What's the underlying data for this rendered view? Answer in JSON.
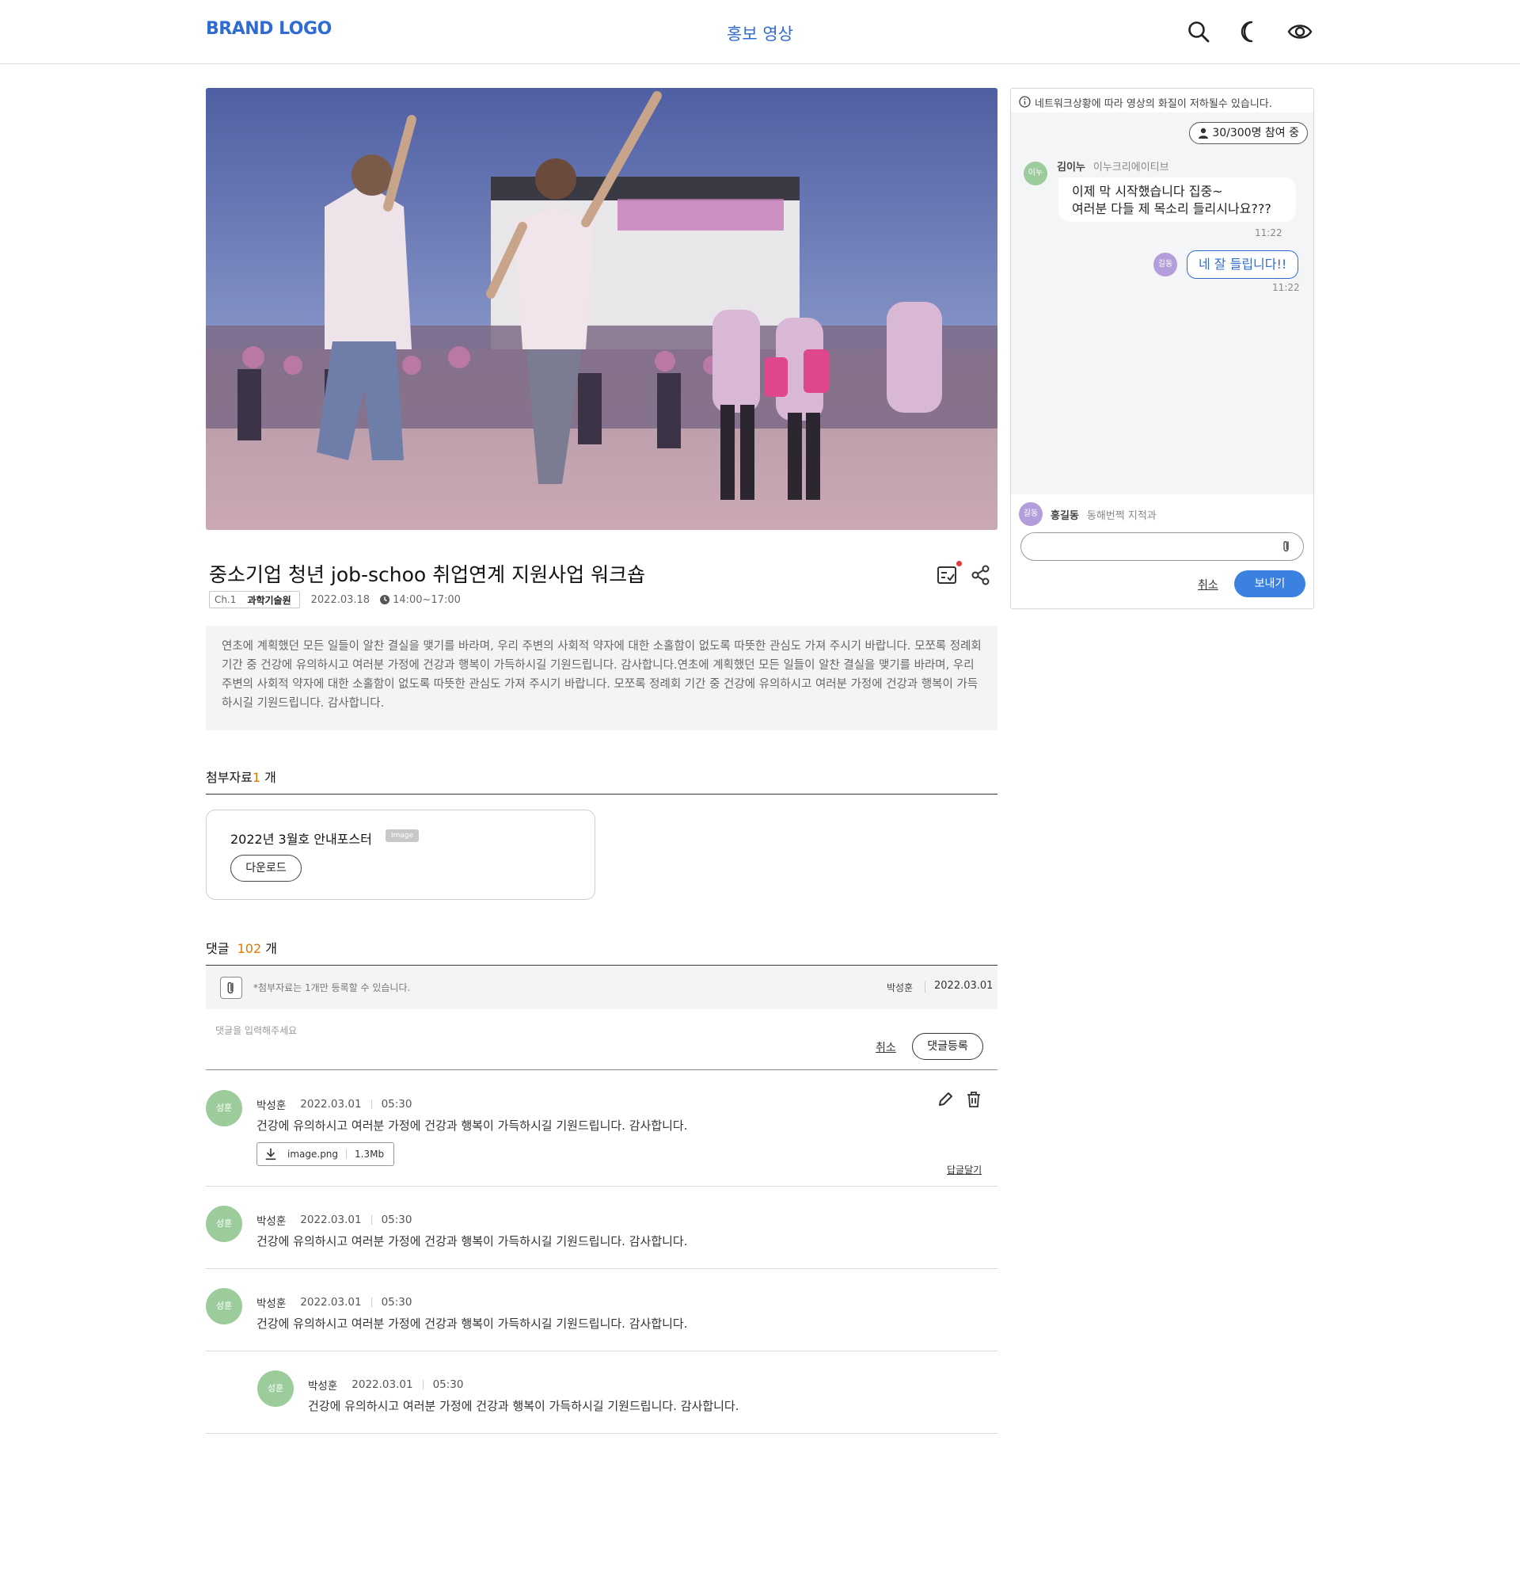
{
  "header": {
    "brand": "BRAND LOGO",
    "title": "홍보 영상",
    "icons": [
      "search-icon",
      "dark-mode-icon",
      "eye-icon"
    ]
  },
  "video": {
    "thumbnail": "festival-crowd-photo"
  },
  "post": {
    "title": "중소기업 청년 job-schoo 취업연계 지원사업 워크숍",
    "channel": "Ch.1",
    "category": "과학기술원",
    "date": "2022.03.18",
    "time": "14:00~17:00",
    "description": "연초에 계획했던 모든 일들이 알찬 결실을 맺기를 바라며, 우리 주변의 사회적 약자에 대한 소홀함이 없도록 따뜻한 관심도 가져 주시기 바랍니다. 모쪼록 정례회 기간 중 건강에 유의하시고 여러분 가정에 건강과 행복이 가득하시길 기원드립니다. 감사합니다.연초에 계획했던 모든 일들이 알찬 결실을 맺기를 바라며, 우리 주변의 사회적 약자에 대한 소홀함이 없도록 따뜻한 관심도 가져 주시기 바랍니다. 모쪼록 정례회 기간 중 건강에 유의하시고 여러분 가정에 건강과 행복이 가득하시길 기원드립니다. 감사합니다."
  },
  "attachments": {
    "label": "첨부자료",
    "count": "1",
    "unit": " 개",
    "file_name": "2022년 3월호 안내포스터",
    "file_tag": "Image",
    "download_label": "다운로드"
  },
  "comments": {
    "label": "댓글",
    "count": "102",
    "unit": " 개",
    "attach_note": "*첨부자료는 1개만 등록할 수 있습니다.",
    "author": "박성훈",
    "date": "2022.03.01",
    "placeholder": "댓글을 입력해주세요",
    "cancel_label": "취소",
    "submit_label": "댓글등록",
    "reply_label": "답글달기",
    "items": [
      {
        "avatar": "성훈",
        "name": "박성훈",
        "date": "2022.03.01",
        "time": "05:30",
        "text": "건강에 유의하시고 여러분 가정에 건강과 행복이 가득하시길 기원드립니다. 감사합니다.",
        "file_name": "image.png",
        "file_size": "1.3Mb"
      },
      {
        "avatar": "성훈",
        "name": "박성훈",
        "date": "2022.03.01",
        "time": "05:30",
        "text": "건강에 유의하시고 여러분 가정에 건강과 행복이 가득하시길 기원드립니다. 감사합니다."
      },
      {
        "avatar": "성훈",
        "name": "박성훈",
        "date": "2022.03.01",
        "time": "05:30",
        "text": "건강에 유의하시고 여러분 가정에 건강과 행복이 가득하시길 기원드립니다. 감사합니다."
      },
      {
        "avatar": "성훈",
        "name": "박성훈",
        "date": "2022.03.01",
        "time": "05:30",
        "text": "건강에 유의하시고 여러분 가정에 건강과 행복이 가득하시길 기원드립니다. 감사합니다."
      }
    ]
  },
  "chat": {
    "notice": "네트워크상황에 따라 영상의 화질이 저하될수 있습니다.",
    "participants": "30/300명 참여 중",
    "messages": [
      {
        "avatar": "이누",
        "name": "김이누",
        "org": "이누크리에이티브",
        "line1": "이제 막 시작했습니다 집중~",
        "line2": "여러분 다들 제 목소리 들리시나요???",
        "time": "11:22"
      },
      {
        "avatar": "길동",
        "text": "네 잘 들립니다!!",
        "time": "11:22"
      }
    ],
    "me": {
      "avatar": "길동",
      "name": "홍길동",
      "org": "동해번쩍 지적과"
    },
    "cancel_label": "취소",
    "send_label": "보내기"
  },
  "colors": {
    "accent": "#2f6bd1",
    "send_button": "#3b82e0",
    "count_highlight": "#e07b00",
    "avatar_green": "#9ccc9c",
    "avatar_purple": "#b39ddb",
    "notify_dot": "#e53935"
  }
}
